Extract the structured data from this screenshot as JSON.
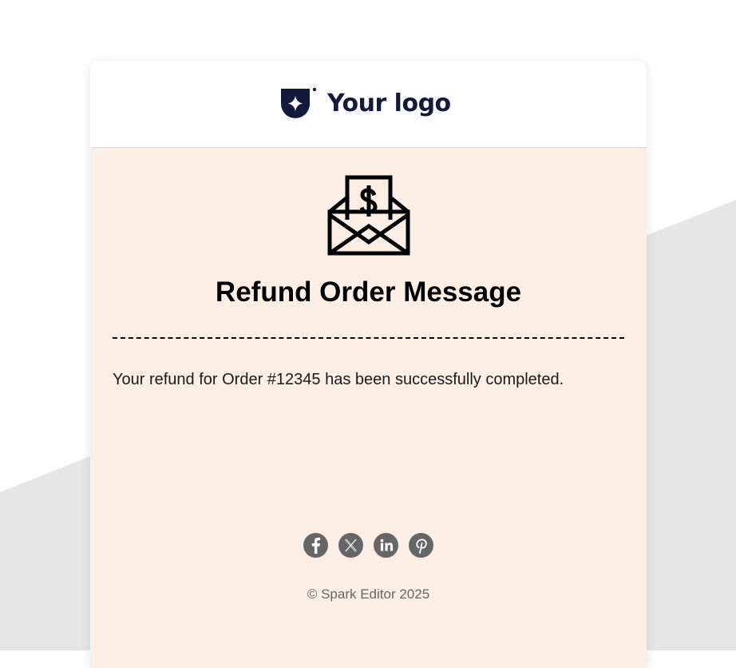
{
  "header": {
    "logo_text": "Your logo"
  },
  "content": {
    "icon": "envelope-dollar-icon",
    "title": "Refund Order Message",
    "message": "Your refund for Order #12345 has been successfully completed."
  },
  "footer": {
    "social_links": [
      {
        "name": "facebook",
        "icon": "facebook-icon"
      },
      {
        "name": "x",
        "icon": "x-icon"
      },
      {
        "name": "linkedin",
        "icon": "linkedin-icon"
      },
      {
        "name": "pinterest",
        "icon": "pinterest-icon"
      }
    ],
    "copyright": "© Spark Editor 2025"
  },
  "colors": {
    "page_background": "#ffffff",
    "background_shape": "#e6e6e6",
    "card_background": "#fbefe5",
    "header_background": "#ffffff",
    "logo_color": "#141a3d",
    "social_icon_background": "#666666",
    "footer_text": "#666666"
  }
}
